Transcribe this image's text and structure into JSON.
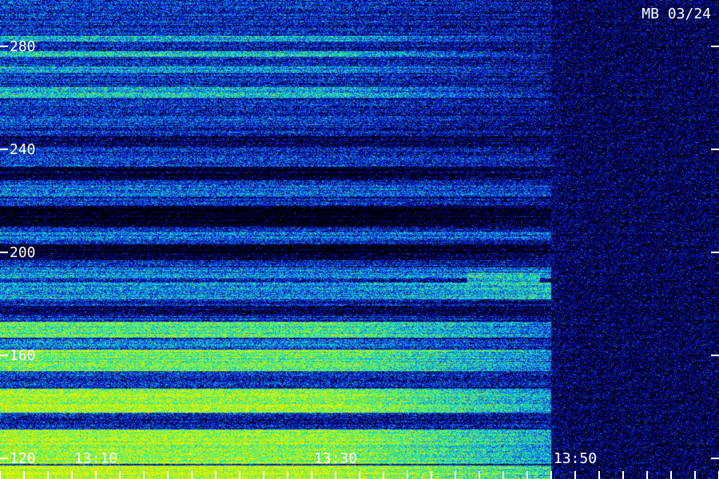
{
  "chart_data": {
    "type": "heatmap",
    "title": "MB 03/24",
    "y_ticks": [
      120,
      160,
      200,
      240,
      280
    ],
    "x_tick_labels": [
      "13:10",
      "13:30",
      "13:50"
    ],
    "xlim": [
      "13:02",
      "14:02"
    ],
    "ylim": [
      112,
      298
    ],
    "x_minor_tick_step_min": 2,
    "colormap": [
      "#000000",
      "#06007a",
      "#1030e8",
      "#10a8e8",
      "#18f0a8",
      "#a8f018",
      "#f0f000"
    ],
    "bands": [
      {
        "y": [
          282,
          284
        ],
        "level": [
          0.55,
          0.22
        ]
      },
      {
        "y": [
          276,
          278
        ],
        "level": [
          0.62,
          0.22
        ]
      },
      {
        "y": [
          270,
          272
        ],
        "level": [
          0.5,
          0.2
        ]
      },
      {
        "y": [
          260,
          264
        ],
        "level": [
          0.55,
          0.2
        ]
      },
      {
        "y": [
          249,
          252
        ],
        "level": [
          0.35,
          0.15
        ]
      },
      {
        "y": [
          241,
          245
        ],
        "level": [
          0.12,
          0.1
        ]
      },
      {
        "y": [
          235,
          238
        ],
        "level": [
          0.35,
          0.25
        ]
      },
      {
        "y": [
          228,
          233
        ],
        "level": [
          0.05,
          0.1
        ]
      },
      {
        "y": [
          222,
          226
        ],
        "level": [
          0.4,
          0.3
        ]
      },
      {
        "y": [
          210,
          218
        ],
        "level": [
          0.0,
          0.06
        ]
      },
      {
        "y": [
          205,
          208
        ],
        "level": [
          0.42,
          0.35
        ]
      },
      {
        "y": [
          197,
          203
        ],
        "level": [
          0.02,
          0.06
        ]
      },
      {
        "y": [
          190,
          194
        ],
        "level": [
          0.45,
          0.42
        ]
      },
      {
        "y": [
          182,
          188
        ],
        "level": [
          0.5,
          0.6
        ]
      },
      {
        "y": [
          176,
          179
        ],
        "level": [
          0.15,
          0.1
        ]
      },
      {
        "y": [
          167,
          173
        ],
        "level": [
          0.72,
          0.4
        ]
      },
      {
        "y": [
          163,
          166
        ],
        "level": [
          0.45,
          0.25
        ]
      },
      {
        "y": [
          154,
          162
        ],
        "level": [
          0.78,
          0.45
        ]
      },
      {
        "y": [
          148,
          152
        ],
        "level": [
          0.3,
          0.22
        ]
      },
      {
        "y": [
          138,
          147
        ],
        "level": [
          0.88,
          0.5
        ]
      },
      {
        "y": [
          132,
          136
        ],
        "level": [
          0.25,
          0.22
        ]
      },
      {
        "y": [
          118,
          131
        ],
        "level": [
          0.85,
          0.5
        ]
      },
      {
        "y": [
          112,
          117
        ],
        "level": [
          0.9,
          0.6
        ]
      }
    ],
    "features": [
      {
        "type": "slope_change",
        "time": "13:30"
      },
      {
        "type": "signal_end",
        "time": "13:48"
      },
      {
        "type": "bright_patch",
        "time": [
          "13:41",
          "13:47"
        ],
        "y": [
          188,
          192
        ]
      }
    ]
  }
}
